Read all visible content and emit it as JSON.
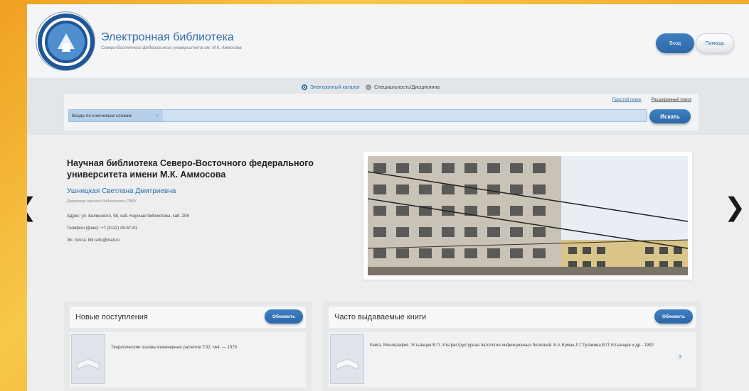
{
  "header": {
    "title": "Электронная библиотека",
    "subtitle": "Северо-Восточного федерального университета им. М.К. Аммосова",
    "login_label": "Вход",
    "help_label": "Помощь"
  },
  "search": {
    "mode_catalog": "Электронный каталог",
    "mode_specialty": "Специальность/Дисциплина",
    "simple_link": "Простой поиск",
    "advanced_link": "Расширенный поиск",
    "field_select": "Везде по ключевым словам",
    "query_value": "",
    "submit_label": "Искать"
  },
  "slide": {
    "title": "Научная библиотека Северо-Восточного федерального университета имени М.К. Аммосова",
    "person": "Ушницкая Светлана Дмитриевна",
    "role": "Директор научной библиотеки СВФУ",
    "address": "Адрес: ул. Белинского, 58, каб. Научная библиотека, каб. 206",
    "phone": "Телефон (факс): +7 (4112) 49-67-61",
    "email": "Эл. почта: libr.svfu@mail.ru"
  },
  "new_books": {
    "title": "Новые поступления",
    "refresh_label": "Обновить",
    "items": [
      {
        "text": "Теоретические основы инженерных расчетов Т.92, №4. — 1970"
      }
    ]
  },
  "popular_books": {
    "title": "Часто выдаваемые книги",
    "refresh_label": "Обновить",
    "items": [
      {
        "text": "Книга. Монография. Устьянцев В.П..Ультраструктурная патология инфекционных болезней. Б.А.Ерман,Л.Г.Тулакина,В.П.Устьянцев и др.- 1992",
        "count": "3"
      }
    ]
  },
  "colors": {
    "accent": "#2f6fa8",
    "background_frame": "#f0a020"
  }
}
